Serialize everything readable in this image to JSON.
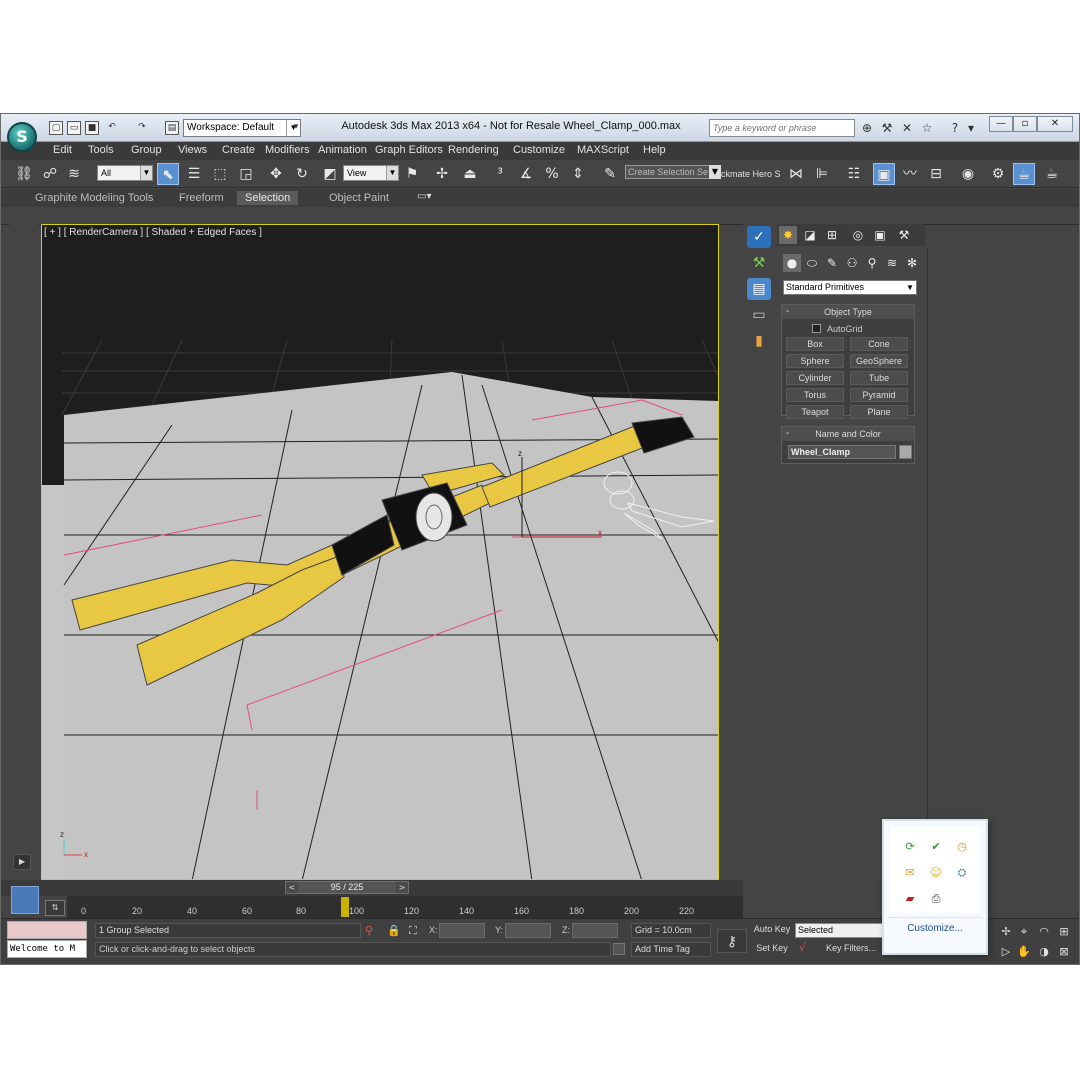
{
  "window": {
    "title": "Autodesk 3ds Max  2013 x64  - Not for Resale     Wheel_Clamp_000.max",
    "logo_letter": "S",
    "workspace": "Workspace: Default",
    "search_placeholder": "Type a keyword or phrase"
  },
  "menu": [
    "Edit",
    "Tools",
    "Group",
    "Views",
    "Create",
    "Modifiers",
    "Animation",
    "Graph Editors",
    "Rendering",
    "Customize",
    "MAXScript",
    "Help"
  ],
  "toolbar": {
    "selection_filter": "All",
    "ref_coord": "View",
    "named_selection": "Create Selection Se",
    "hero_label": "ckmate Hero S"
  },
  "ribbon": {
    "tabs": [
      "Graphite Modeling Tools",
      "Freeform",
      "Selection",
      "Object Paint"
    ],
    "active_tab": "Selection"
  },
  "viewport": {
    "label": "[ + ] [ RenderCamera ] [ Shaded + Edged Faces ]",
    "axis_z": "z",
    "axis_x": "x",
    "gizmo_z": "z",
    "gizmo_x": "x"
  },
  "command_panel": {
    "category": "Standard Primitives",
    "object_type_title": "Object Type",
    "autogrid_label": "AutoGrid",
    "primitives": [
      "Box",
      "Cone",
      "Sphere",
      "GeoSphere",
      "Cylinder",
      "Tube",
      "Torus",
      "Pyramid",
      "Teapot",
      "Plane"
    ],
    "name_color_title": "Name and Color",
    "object_name": "Wheel_Clamp",
    "object_color": "#a9a9a9"
  },
  "time": {
    "slider_label": "95 / 225",
    "ticks": [
      "0",
      "20",
      "40",
      "60",
      "80",
      "100",
      "120",
      "140",
      "160",
      "180",
      "200",
      "220"
    ]
  },
  "status": {
    "maxscript_text": "Welcome to M",
    "selection": "1 Group Selected",
    "prompt": "Click or click-and-drag to select objects",
    "x_label": "X:",
    "y_label": "Y:",
    "z_label": "Z:",
    "grid": "Grid = 10.0cm",
    "add_time_tag": "Add Time Tag",
    "auto_key": "Auto Key",
    "set_key": "Set Key",
    "key_mode": "Selected",
    "key_filters": "Key Filters..."
  },
  "tray": {
    "customize": "Customize..."
  },
  "colors": {
    "accent_yellow": "#e8c843",
    "viewport_border": "#d8d000",
    "active_tool": "#5a8fd0"
  }
}
